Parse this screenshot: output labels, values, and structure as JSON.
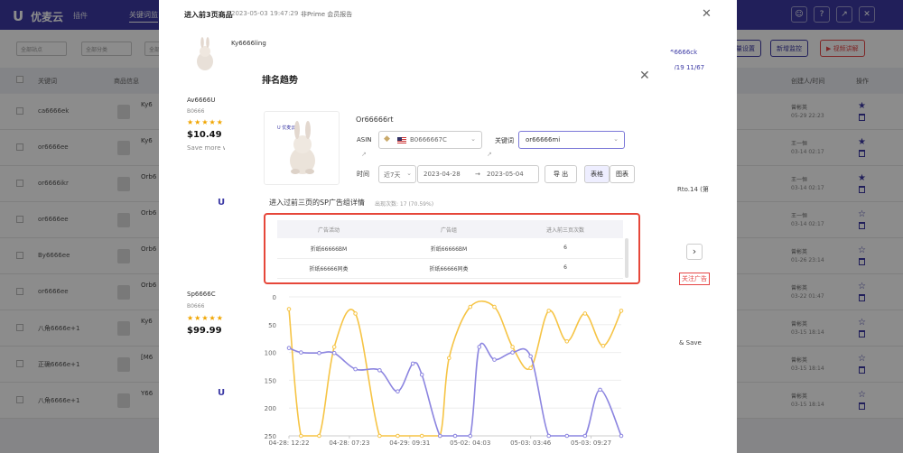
{
  "app": {
    "logo_icon": "U",
    "logo_text": "优麦云",
    "logo_sub": "插件",
    "nav_tab": "关键词监",
    "window_buttons": [
      "user-icon",
      "help-icon",
      "expand-icon",
      "close-icon"
    ]
  },
  "bg_filters": [
    "全部站点",
    "全部分类",
    "全部状态"
  ],
  "bg_actions": {
    "batch": "批量设置",
    "add_monitor": "新增监控",
    "tutorial": "视频讲解"
  },
  "bg_table": {
    "headers": {
      "keyword": "关键词",
      "product": "商品信息",
      "creator": "创建人/时间",
      "ops": "操作"
    },
    "rows": [
      {
        "keyword": "ca6666ek",
        "title": "Ky6",
        "creator": "曾彬英",
        "time": "05-29 22:23"
      },
      {
        "keyword": "or6666ee",
        "title": "Ky6",
        "creator": "王一恒",
        "time": "03-14 02:17"
      },
      {
        "keyword": "or6666ikr",
        "title": "Orb6",
        "creator": "王一恒",
        "time": "03-14 02:17"
      },
      {
        "keyword": "or6666ee",
        "title": "Orb6",
        "creator": "王一恒",
        "time": "03-14 02:17"
      },
      {
        "keyword": "By6666ee",
        "title": "Orb6",
        "creator": "曾彬英",
        "time": "01-26 23:14"
      },
      {
        "keyword": "or6666ee",
        "title": "Orb6",
        "creator": "曾彬英",
        "time": "03-22 01:47"
      },
      {
        "keyword": "八角6666e+1",
        "title": "Ky6",
        "creator": "曾彬英",
        "time": "03-15 18:14"
      },
      {
        "keyword": "正确6666e+1",
        "title": "[M6",
        "creator": "曾彬英",
        "time": "03-15 18:14"
      },
      {
        "keyword": "八角6666e+1",
        "title": "Y66",
        "creator": "曾彬英",
        "time": "03-15 18:14"
      }
    ]
  },
  "mid_modal": {
    "title": "进入前3页商品",
    "datetime": "2023-05-03 19:47:29",
    "tag": "非Prime 会员报告",
    "product_title": "Ky6666ling",
    "link": "66666ck",
    "link_date": "6/19 11/67",
    "cards": [
      {
        "title": "Av6666U",
        "asin": "B0666",
        "price": "$10.49",
        "save": "Save more w",
        "u": "U"
      },
      {
        "title": "Sp6666C",
        "asin": "B0666",
        "price": "$99.99",
        "save": "",
        "u": "U"
      }
    ],
    "row_texts": [
      "Rto.14 (第",
      "& Save"
    ],
    "red_badge": "关注广告"
  },
  "modal": {
    "title": "排名趋势",
    "product_title": "Or66666rt",
    "prod_brand": "U 优麦云",
    "asin_label": "ASIN",
    "asin_value": "B0666667C",
    "keyword_label": "关键词",
    "keyword_value": "or66666mi",
    "time_label": "时间",
    "range_value": "近7天",
    "date_start": "2023-04-28",
    "date_arrow": "→",
    "date_end": "2023-05-04",
    "export_label": "导 出",
    "view_table": "表格",
    "view_chart": "图表",
    "section_title": "进入过前三页的SP广告组详情",
    "section_stat": "出现次数: 17  (70.59%)",
    "table": {
      "headers": [
        "广告活动",
        "广告组",
        "进入前三页次数"
      ],
      "rows": [
        [
          "折纸66666BM",
          "折纸66666BM",
          "6"
        ],
        [
          "折纸66666同类",
          "折纸66666同类",
          "6"
        ]
      ]
    }
  },
  "colors": {
    "brand": "#3c3aa5",
    "highlight_border": "#e6473a",
    "series_yellow": "#f6c445",
    "series_purple": "#8c85e0"
  },
  "chart_data": {
    "type": "line",
    "title": "",
    "xlabel": "",
    "ylabel": "",
    "reversed_y": true,
    "ylim": [
      0,
      250
    ],
    "yticks": [
      0,
      50,
      100,
      150,
      200,
      250
    ],
    "xticks": [
      "04-28: 12:22",
      "04-28: 07:23",
      "04-29: 09:31",
      "05-02: 04:03",
      "05-03: 03:46",
      "05-03: 09:27"
    ],
    "series": [
      {
        "color": "#f6c445",
        "points": [
          [
            0,
            22
          ],
          [
            0.2,
            250
          ],
          [
            0.5,
            250
          ],
          [
            0.75,
            90
          ],
          [
            1.1,
            30
          ],
          [
            1.5,
            250
          ],
          [
            1.8,
            250
          ],
          [
            2.2,
            250
          ],
          [
            2.5,
            250
          ],
          [
            2.65,
            110
          ],
          [
            3.0,
            18
          ],
          [
            3.4,
            18
          ],
          [
            3.7,
            90
          ],
          [
            4.0,
            128
          ],
          [
            4.3,
            25
          ],
          [
            4.6,
            80
          ],
          [
            4.9,
            30
          ],
          [
            5.2,
            88
          ],
          [
            5.5,
            25
          ]
        ]
      },
      {
        "color": "#8c85e0",
        "points": [
          [
            0,
            92
          ],
          [
            0.2,
            100
          ],
          [
            0.5,
            101
          ],
          [
            0.75,
            101
          ],
          [
            1.1,
            130
          ],
          [
            1.5,
            132
          ],
          [
            1.8,
            170
          ],
          [
            2.05,
            120
          ],
          [
            2.2,
            140
          ],
          [
            2.5,
            250
          ],
          [
            2.75,
            250
          ],
          [
            3.0,
            250
          ],
          [
            3.15,
            90
          ],
          [
            3.4,
            113
          ],
          [
            3.7,
            100
          ],
          [
            4.0,
            107
          ],
          [
            4.3,
            250
          ],
          [
            4.6,
            250
          ],
          [
            4.9,
            250
          ],
          [
            5.15,
            167
          ],
          [
            5.5,
            250
          ]
        ]
      }
    ]
  }
}
